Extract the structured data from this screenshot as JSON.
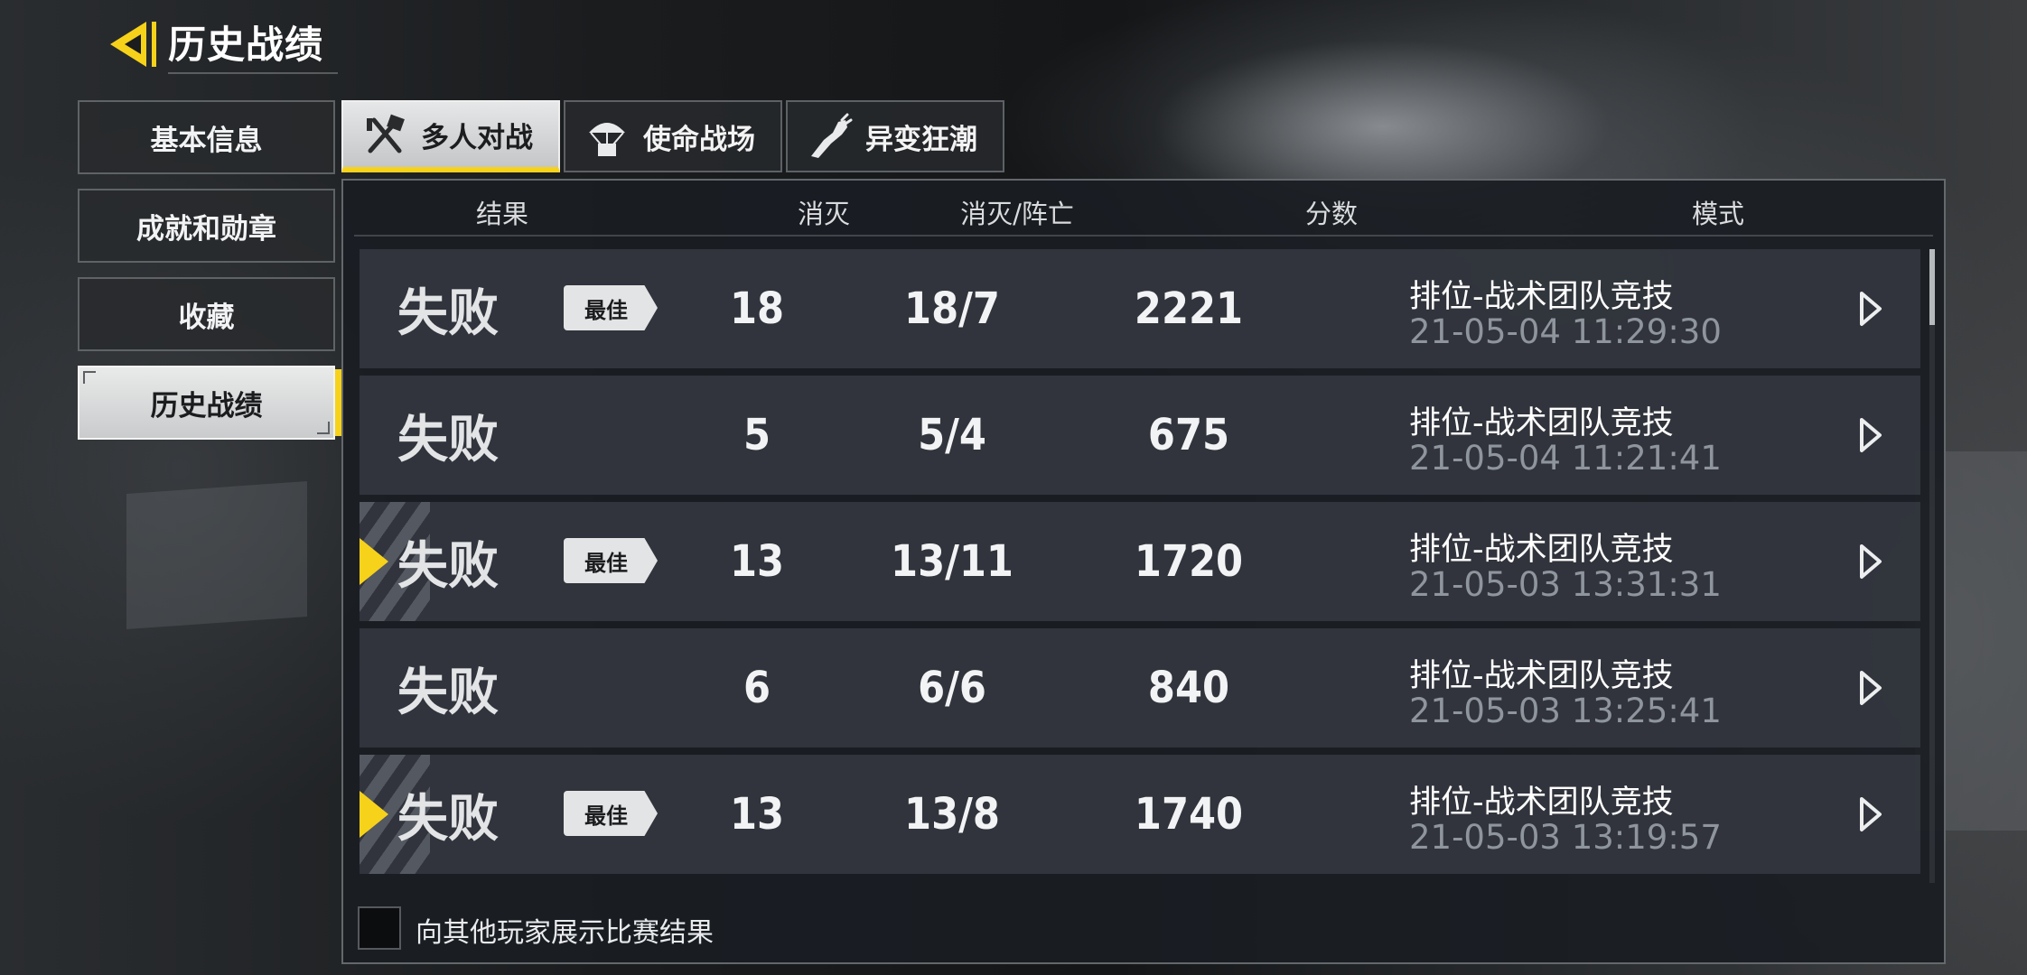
{
  "header": {
    "title": "历史战绩"
  },
  "side_menu": [
    {
      "label": "基本信息",
      "active": false
    },
    {
      "label": "成就和勋章",
      "active": false
    },
    {
      "label": "收藏",
      "active": false
    },
    {
      "label": "历史战绩",
      "active": true
    }
  ],
  "tabs": [
    {
      "label": "多人对战",
      "icon": "crossed-guns-icon",
      "active": true
    },
    {
      "label": "使命战场",
      "icon": "parachute-crate-icon",
      "active": false
    },
    {
      "label": "异变狂潮",
      "icon": "zombie-arm-icon",
      "active": false
    }
  ],
  "columns": {
    "result": "结果",
    "kills": "消灭",
    "kd": "消灭/阵亡",
    "score": "分数",
    "mode": "模式"
  },
  "badge_label": "最佳",
  "rows": [
    {
      "result": "失败",
      "best": true,
      "highlight": false,
      "kills": "18",
      "kd": "18/7",
      "score": "2221",
      "mode": "排位-战术团队竞技",
      "time": "21-05-04 11:29:30"
    },
    {
      "result": "失败",
      "best": false,
      "highlight": false,
      "kills": "5",
      "kd": "5/4",
      "score": "675",
      "mode": "排位-战术团队竞技",
      "time": "21-05-04 11:21:41"
    },
    {
      "result": "失败",
      "best": true,
      "highlight": true,
      "kills": "13",
      "kd": "13/11",
      "score": "1720",
      "mode": "排位-战术团队竞技",
      "time": "21-05-03 13:31:31"
    },
    {
      "result": "失败",
      "best": false,
      "highlight": false,
      "kills": "6",
      "kd": "6/6",
      "score": "840",
      "mode": "排位-战术团队竞技",
      "time": "21-05-03 13:25:41"
    },
    {
      "result": "失败",
      "best": true,
      "highlight": true,
      "kills": "13",
      "kd": "13/8",
      "score": "1740",
      "mode": "排位-战术团队竞技",
      "time": "21-05-03 13:19:57"
    }
  ],
  "footer": {
    "checkbox_label": "向其他玩家展示比赛结果",
    "checked": false
  },
  "colors": {
    "accent": "#f7d21a",
    "panel": "#1a1d22",
    "row": "#343840"
  }
}
